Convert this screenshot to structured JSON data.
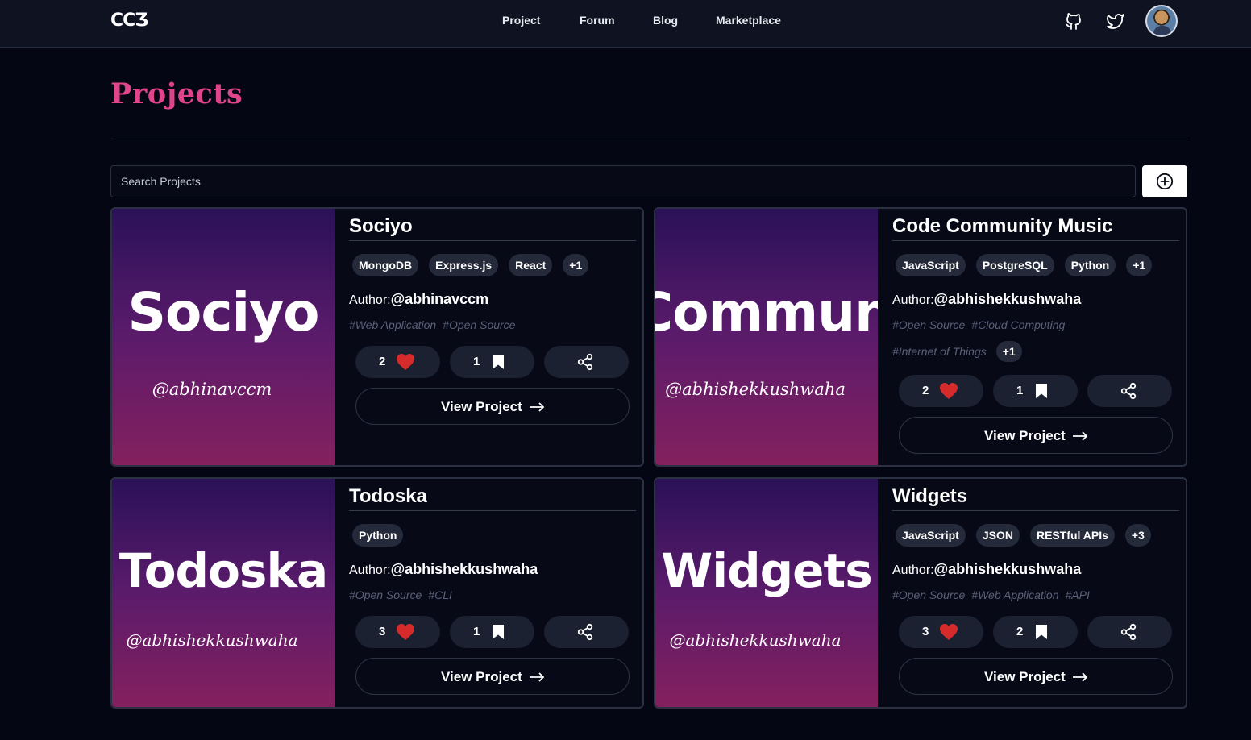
{
  "nav": {
    "logo": "CCƷ",
    "links": [
      "Project",
      "Forum",
      "Blog",
      "Marketplace"
    ],
    "icons": [
      "github-icon",
      "twitter-icon"
    ],
    "avatar": "user-avatar"
  },
  "page": {
    "title": "Projects",
    "search_placeholder": "Search Projects",
    "add_icon": "plus-circle-icon"
  },
  "projects": [
    {
      "thumb_title": "Sociyo",
      "thumb_handle": "@abhinavccm",
      "title": "Sociyo",
      "tags": [
        "MongoDB",
        "Express.js",
        "React",
        "+1"
      ],
      "author_label": "Author:",
      "author": "@abhinavccm",
      "hashtags": [
        "#Web Application",
        "#Open Source"
      ],
      "extra_hashtags": "",
      "likes": "2",
      "bookmarks": "1",
      "view_label": "View Project"
    },
    {
      "thumb_title": "Code Community Music",
      "thumb_handle": "@abhishekkushwaha",
      "title": "Code Community Music",
      "tags": [
        "JavaScript",
        "PostgreSQL",
        "Python",
        "+1"
      ],
      "author_label": "Author:",
      "author": "@abhishekkushwaha",
      "hashtags": [
        "#Open Source",
        "#Cloud Computing"
      ],
      "hashtags_row2": [
        "#Internet of Things"
      ],
      "extra_hashtags": "+1",
      "likes": "2",
      "bookmarks": "1",
      "view_label": "View Project"
    },
    {
      "thumb_title": "Todoska",
      "thumb_handle": "@abhishekkushwaha",
      "title": "Todoska",
      "tags": [
        "Python"
      ],
      "author_label": "Author:",
      "author": "@abhishekkushwaha",
      "hashtags": [
        "#Open Source",
        "#CLI"
      ],
      "extra_hashtags": "",
      "likes": "3",
      "bookmarks": "1",
      "view_label": "View Project"
    },
    {
      "thumb_title": "Widgets",
      "thumb_handle": "@abhishekkushwaha",
      "title": "Widgets",
      "tags": [
        "JavaScript",
        "JSON",
        "RESTful APIs",
        "+3"
      ],
      "author_label": "Author:",
      "author": "@abhishekkushwaha",
      "hashtags": [
        "#Open Source",
        "#Web Application",
        "#API"
      ],
      "extra_hashtags": "",
      "likes": "3",
      "bookmarks": "2",
      "view_label": "View Project"
    }
  ],
  "colors": {
    "background": "#050614",
    "navbar": "#0e1221",
    "title_accent": "#e0458c",
    "heart": "#d62b2b",
    "thumb_gradient_top": "#2a1158",
    "thumb_gradient_bottom": "#84205e"
  }
}
